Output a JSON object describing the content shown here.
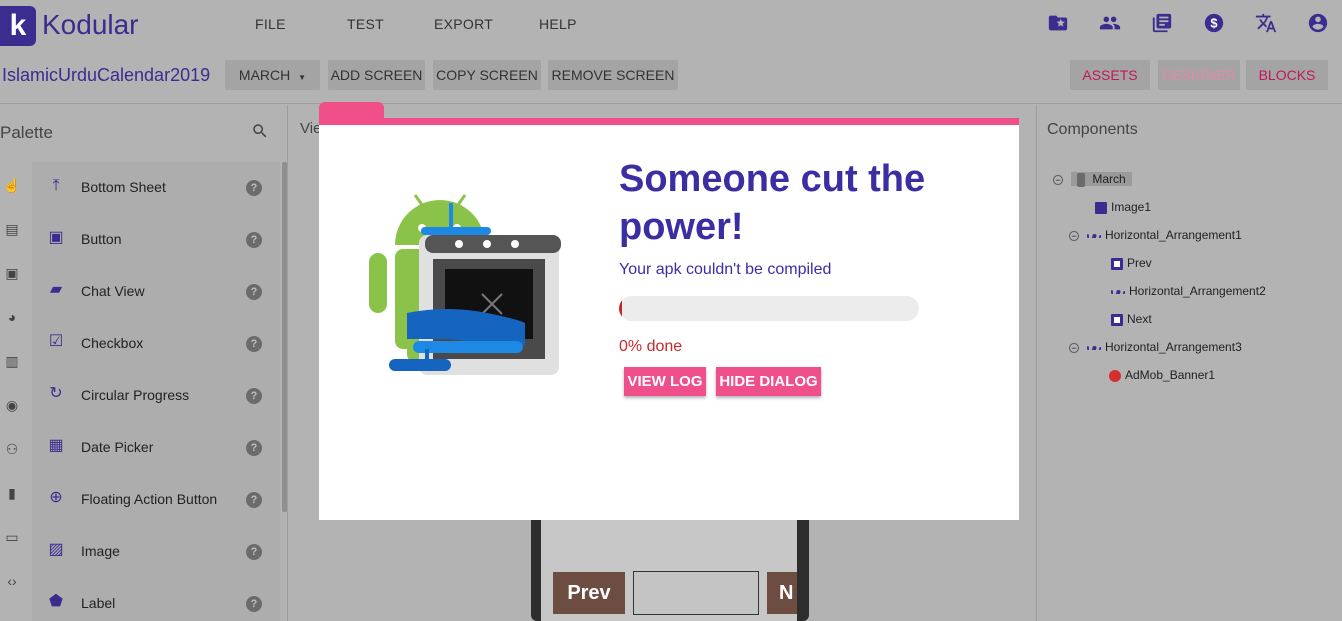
{
  "app": {
    "logo_letter": "k",
    "name": "Kodular"
  },
  "menu": {
    "file": "FILE",
    "test": "TEST",
    "export": "EXPORT",
    "help": "HELP"
  },
  "top_icons": [
    "folder-star-icon",
    "people-icon",
    "library-icon",
    "dollar-icon",
    "translate-icon",
    "account-icon"
  ],
  "toolbar": {
    "project_name": "IslamicUrduCalendar2019",
    "screen_select": "MARCH",
    "add_screen": "ADD SCREEN",
    "copy_screen": "COPY SCREEN",
    "remove_screen": "REMOVE SCREEN",
    "assets": "ASSETS",
    "designer": "DESIGNER",
    "blocks": "BLOCKS"
  },
  "palette": {
    "title": "Palette",
    "items": [
      {
        "label": "Bottom Sheet",
        "help": "?"
      },
      {
        "label": "Button",
        "help": "?"
      },
      {
        "label": "Chat View",
        "help": "?"
      },
      {
        "label": "Checkbox",
        "help": "?"
      },
      {
        "label": "Circular Progress",
        "help": "?"
      },
      {
        "label": "Date Picker",
        "help": "?"
      },
      {
        "label": "Floating Action Button",
        "help": "?"
      },
      {
        "label": "Image",
        "help": "?"
      },
      {
        "label": "Label",
        "help": "?"
      }
    ]
  },
  "viewer": {
    "label": "Vie",
    "prev_button": "Prev",
    "next_button": "N"
  },
  "components": {
    "title": "Components",
    "tree": [
      {
        "label": "March"
      },
      {
        "label": "Image1"
      },
      {
        "label": "Horizontal_Arrangement1"
      },
      {
        "label": "Prev"
      },
      {
        "label": "Horizontal_Arrangement2"
      },
      {
        "label": "Next"
      },
      {
        "label": "Horizontal_Arrangement3"
      },
      {
        "label": "AdMob_Banner1"
      }
    ]
  },
  "dialog": {
    "title": "Someone cut the power!",
    "subtitle": "Your apk couldn't be compiled",
    "progress_percent": 0,
    "progress_text": "0% done",
    "view_log": "VIEW LOG",
    "hide_dialog": "HIDE DIALOG"
  },
  "colors": {
    "accent": "#3b2ea3",
    "pink": "#f0508a",
    "error": "#c62828"
  }
}
